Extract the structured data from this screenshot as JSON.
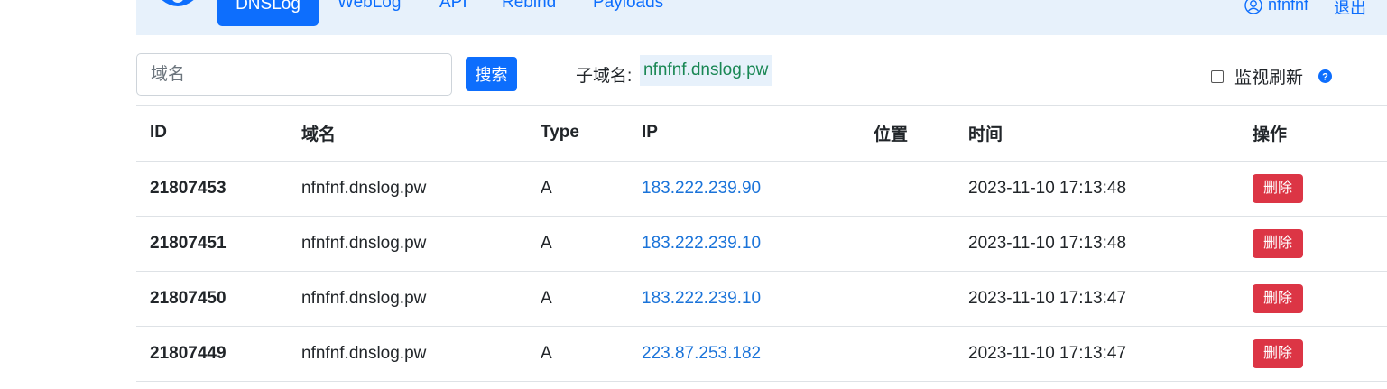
{
  "nav": {
    "active": "DNSLog",
    "items": [
      "WebLog",
      "API",
      "Rebind",
      "Payloads"
    ],
    "user": "nfnfnf",
    "logout": "退出"
  },
  "search": {
    "placeholder": "域名",
    "button": "搜索"
  },
  "subdomain": {
    "label": "子域名:",
    "value": "nfnfnf.dnslog.pw"
  },
  "monitor": {
    "label": "监视刷新",
    "checked": false
  },
  "table": {
    "headers": [
      "ID",
      "域名",
      "Type",
      "IP",
      "位置",
      "时间",
      "操作"
    ],
    "rows": [
      {
        "id": "21807453",
        "domain": "nfnfnf.dnslog.pw",
        "type": "A",
        "ip": "183.222.239.90",
        "location": "",
        "time": "2023-11-10 17:13:48",
        "action": "删除"
      },
      {
        "id": "21807451",
        "domain": "nfnfnf.dnslog.pw",
        "type": "A",
        "ip": "183.222.239.10",
        "location": "",
        "time": "2023-11-10 17:13:48",
        "action": "删除"
      },
      {
        "id": "21807450",
        "domain": "nfnfnf.dnslog.pw",
        "type": "A",
        "ip": "183.222.239.10",
        "location": "",
        "time": "2023-11-10 17:13:47",
        "action": "删除"
      },
      {
        "id": "21807449",
        "domain": "nfnfnf.dnslog.pw",
        "type": "A",
        "ip": "223.87.253.182",
        "location": "",
        "time": "2023-11-10 17:13:47",
        "action": "删除"
      }
    ]
  },
  "colors": {
    "primary": "#0d6efd",
    "danger": "#dc3545",
    "success": "#198754",
    "navbar_bg": "#e7f1fb"
  }
}
